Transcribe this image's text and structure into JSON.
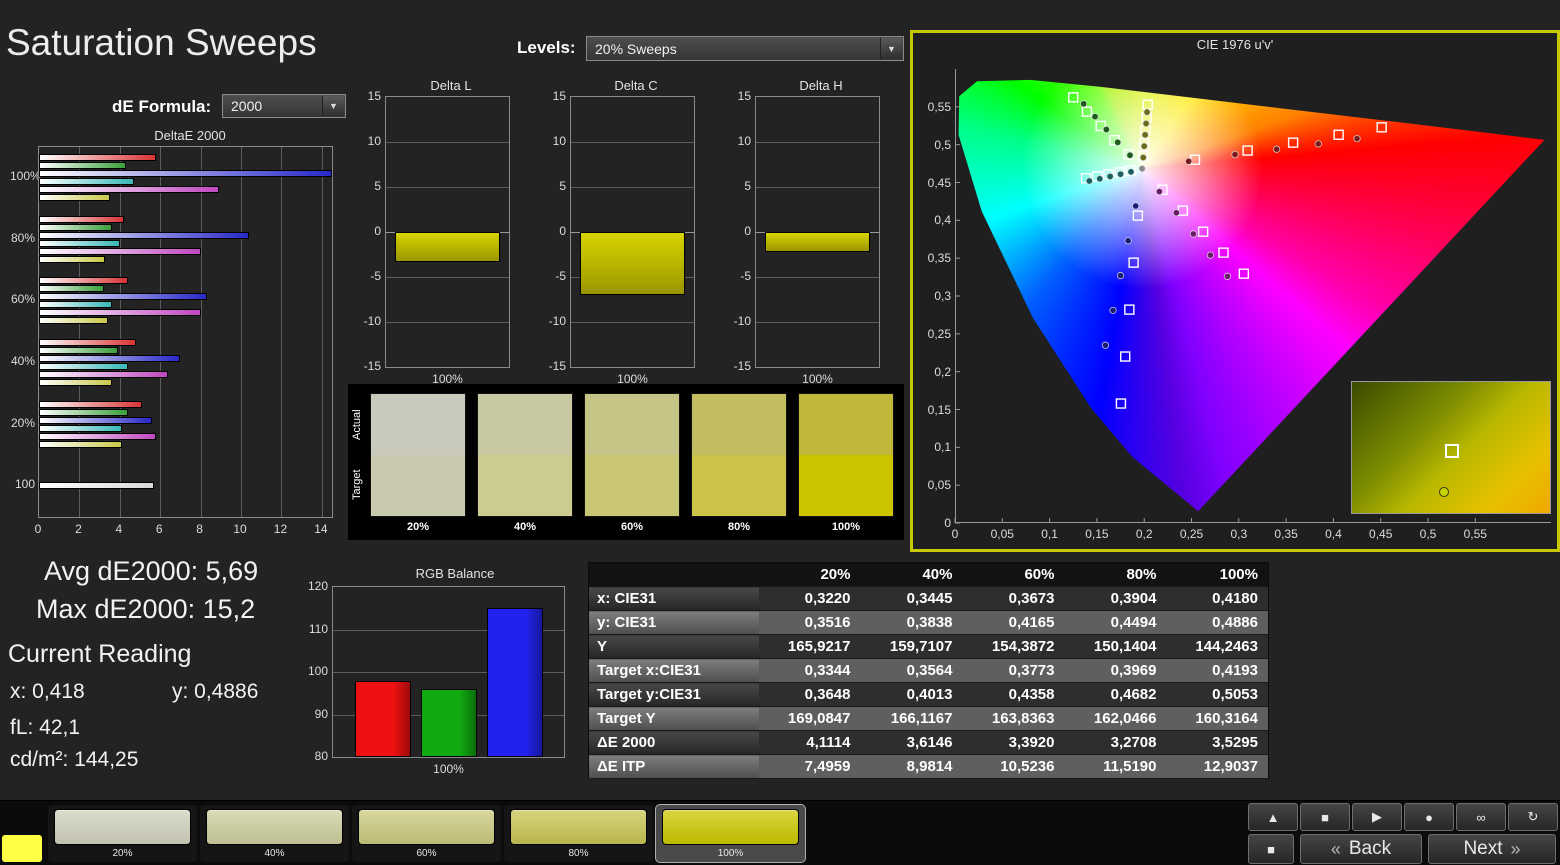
{
  "header": {
    "title": "Saturation Sweeps",
    "levels_label": "Levels:",
    "levels_value": "20% Sweeps",
    "de_formula_label": "dE Formula:",
    "de_formula_value": "2000",
    "accent_color": "#c8c800"
  },
  "stats": {
    "avg": "Avg dE2000: 5,69",
    "max": "Max dE2000: 15,2",
    "current_reading_title": "Current Reading",
    "x_value": "x: 0,418",
    "y_value": "y: 0,4886",
    "fl_value": "fL: 42,1",
    "cd_value": "cd/m²: 144,25"
  },
  "chart_data": {
    "deltae": {
      "type": "bar",
      "orientation": "horizontal",
      "title": "DeltaE 2000",
      "x_ticks": [
        0,
        2,
        4,
        6,
        8,
        10,
        12,
        14
      ],
      "xmax": 14.5,
      "groups": [
        {
          "label": "100%",
          "bars": [
            {
              "name": "red",
              "color": "#d83434",
              "v": 5.8
            },
            {
              "name": "green",
              "color": "#3aa03a",
              "v": 4.3
            },
            {
              "name": "blue",
              "color": "#2828c8",
              "v": 15.2
            },
            {
              "name": "cyan",
              "color": "#38b8b8",
              "v": 4.7
            },
            {
              "name": "magenta",
              "color": "#c048c0",
              "v": 8.9
            },
            {
              "name": "yellow",
              "color": "#c8c848",
              "v": 3.53
            }
          ]
        },
        {
          "label": "80%",
          "bars": [
            {
              "name": "red",
              "color": "#d83434",
              "v": 4.2
            },
            {
              "name": "green",
              "color": "#3aa03a",
              "v": 3.6
            },
            {
              "name": "blue",
              "color": "#2828c8",
              "v": 10.4
            },
            {
              "name": "cyan",
              "color": "#38b8b8",
              "v": 4.0
            },
            {
              "name": "magenta",
              "color": "#c048c0",
              "v": 8.0
            },
            {
              "name": "yellow",
              "color": "#c8c848",
              "v": 3.27
            }
          ]
        },
        {
          "label": "60%",
          "bars": [
            {
              "name": "red",
              "color": "#d83434",
              "v": 4.4
            },
            {
              "name": "green",
              "color": "#3aa03a",
              "v": 3.2
            },
            {
              "name": "blue",
              "color": "#2828c8",
              "v": 8.3
            },
            {
              "name": "cyan",
              "color": "#38b8b8",
              "v": 3.6
            },
            {
              "name": "magenta",
              "color": "#c048c0",
              "v": 8.0
            },
            {
              "name": "yellow",
              "color": "#c8c848",
              "v": 3.39
            }
          ]
        },
        {
          "label": "40%",
          "bars": [
            {
              "name": "red",
              "color": "#d83434",
              "v": 4.8
            },
            {
              "name": "green",
              "color": "#3aa03a",
              "v": 3.9
            },
            {
              "name": "blue",
              "color": "#2828c8",
              "v": 7.0
            },
            {
              "name": "cyan",
              "color": "#38b8b8",
              "v": 4.4
            },
            {
              "name": "magenta",
              "color": "#c048c0",
              "v": 6.4
            },
            {
              "name": "yellow",
              "color": "#c8c848",
              "v": 3.61
            }
          ]
        },
        {
          "label": "20%",
          "bars": [
            {
              "name": "red",
              "color": "#d83434",
              "v": 5.1
            },
            {
              "name": "green",
              "color": "#3aa03a",
              "v": 4.4
            },
            {
              "name": "blue",
              "color": "#2828c8",
              "v": 5.6
            },
            {
              "name": "cyan",
              "color": "#38b8b8",
              "v": 4.1
            },
            {
              "name": "magenta",
              "color": "#c048c0",
              "v": 5.8
            },
            {
              "name": "yellow",
              "color": "#c8c848",
              "v": 4.11
            }
          ]
        },
        {
          "label": "100",
          "bars": [
            {
              "name": "white",
              "color": "#d8d8d8",
              "v": 5.7
            }
          ]
        }
      ]
    },
    "delta_bars": [
      {
        "title": "Delta L",
        "xlabel": "100%",
        "v": -3.3,
        "ymin": -15,
        "ymax": 15,
        "ticks": [
          15,
          10,
          5,
          0,
          -5,
          -10,
          -15
        ],
        "bar_color": "#d8d400"
      },
      {
        "title": "Delta C",
        "xlabel": "100%",
        "v": -7.0,
        "ymin": -15,
        "ymax": 15,
        "ticks": [
          15,
          10,
          5,
          0,
          -5,
          -10,
          -15
        ],
        "bar_color": "#d8d400"
      },
      {
        "title": "Delta H",
        "xlabel": "100%",
        "v": -2.2,
        "ymin": -15,
        "ymax": 15,
        "ticks": [
          15,
          10,
          5,
          0,
          -5,
          -10,
          -15
        ],
        "bar_color": "#d8d400"
      }
    ],
    "rgb_balance": {
      "type": "bar",
      "title": "RGB Balance",
      "xlabel": "100%",
      "ymin": 80,
      "ymax": 120,
      "ticks": [
        120,
        110,
        100,
        90,
        80
      ],
      "bars": [
        {
          "name": "red",
          "color": "#ee1111",
          "v": 98
        },
        {
          "name": "green",
          "color": "#11aa11",
          "v": 96
        },
        {
          "name": "blue",
          "color": "#2222ee",
          "v": 115
        }
      ]
    },
    "cie": {
      "type": "scatter",
      "title": "CIE 1976 u'v'",
      "umax": 0.63,
      "vmax": 0.6,
      "tick_values": [
        0,
        0.05,
        0.1,
        0.15,
        0.2,
        0.25,
        0.3,
        0.35,
        0.4,
        0.45,
        0.5,
        0.55
      ],
      "tick_labels": [
        "0",
        "0,05",
        "0,1",
        "0,15",
        "0,2",
        "0,25",
        "0,3",
        "0,35",
        "0,4",
        "0,45",
        "0,5",
        "0,55"
      ],
      "white_point": [
        0.1978,
        0.4683
      ],
      "targets": [
        [
          0.2537,
          0.4801
        ],
        [
          0.3093,
          0.4922
        ],
        [
          0.3574,
          0.5027
        ],
        [
          0.4055,
          0.5131
        ],
        [
          0.451,
          0.5229
        ],
        [
          0.1832,
          0.4871
        ],
        [
          0.1686,
          0.5059
        ],
        [
          0.154,
          0.5248
        ],
        [
          0.1395,
          0.5436
        ],
        [
          0.125,
          0.5625
        ],
        [
          0.1933,
          0.4062
        ],
        [
          0.1888,
          0.3441
        ],
        [
          0.1843,
          0.282
        ],
        [
          0.1799,
          0.22
        ],
        [
          0.1754,
          0.1579
        ],
        [
          0.1859,
          0.4658
        ],
        [
          0.1741,
          0.4633
        ],
        [
          0.1622,
          0.4608
        ],
        [
          0.1504,
          0.4582
        ],
        [
          0.1385,
          0.4557
        ],
        [
          0.2193,
          0.4405
        ],
        [
          0.2408,
          0.4128
        ],
        [
          0.2623,
          0.385
        ],
        [
          0.2838,
          0.3573
        ],
        [
          0.3053,
          0.3295
        ],
        [
          0.199,
          0.4852
        ],
        [
          0.2002,
          0.5021
        ],
        [
          0.2014,
          0.519
        ],
        [
          0.2026,
          0.5359
        ],
        [
          0.2038,
          0.5528
        ]
      ],
      "measurements": [
        {
          "u": 0.247,
          "v": 0.478,
          "color": "#7a1a1a"
        },
        {
          "u": 0.296,
          "v": 0.487,
          "color": "#7a1a1a"
        },
        {
          "u": 0.34,
          "v": 0.494,
          "color": "#7a1a1a"
        },
        {
          "u": 0.384,
          "v": 0.501,
          "color": "#7a1a1a"
        },
        {
          "u": 0.425,
          "v": 0.508,
          "color": "#7a1a1a"
        },
        {
          "u": 0.185,
          "v": 0.486,
          "color": "#1a5c1a"
        },
        {
          "u": 0.172,
          "v": 0.503,
          "color": "#1a5c1a"
        },
        {
          "u": 0.16,
          "v": 0.52,
          "color": "#1a5c1a"
        },
        {
          "u": 0.148,
          "v": 0.537,
          "color": "#1a5c1a"
        },
        {
          "u": 0.136,
          "v": 0.554,
          "color": "#1a5c1a"
        },
        {
          "u": 0.191,
          "v": 0.419,
          "color": "#1a1a7a"
        },
        {
          "u": 0.183,
          "v": 0.373,
          "color": "#1a1a7a"
        },
        {
          "u": 0.175,
          "v": 0.327,
          "color": "#1a1a7a"
        },
        {
          "u": 0.167,
          "v": 0.281,
          "color": "#1a1a7a"
        },
        {
          "u": 0.159,
          "v": 0.235,
          "color": "#1a1a7a"
        },
        {
          "u": 0.186,
          "v": 0.464,
          "color": "#1a6060"
        },
        {
          "u": 0.175,
          "v": 0.461,
          "color": "#1a6060"
        },
        {
          "u": 0.164,
          "v": 0.458,
          "color": "#1a6060"
        },
        {
          "u": 0.153,
          "v": 0.455,
          "color": "#1a6060"
        },
        {
          "u": 0.142,
          "v": 0.452,
          "color": "#1a6060"
        },
        {
          "u": 0.216,
          "v": 0.438,
          "color": "#6a1a6a"
        },
        {
          "u": 0.234,
          "v": 0.41,
          "color": "#6a1a6a"
        },
        {
          "u": 0.252,
          "v": 0.382,
          "color": "#6a1a6a"
        },
        {
          "u": 0.27,
          "v": 0.354,
          "color": "#6a1a6a"
        },
        {
          "u": 0.288,
          "v": 0.326,
          "color": "#6a1a6a"
        },
        {
          "u": 0.199,
          "v": 0.483,
          "color": "#6a6a1a"
        },
        {
          "u": 0.2,
          "v": 0.498,
          "color": "#6a6a1a"
        },
        {
          "u": 0.201,
          "v": 0.513,
          "color": "#6a6a1a"
        },
        {
          "u": 0.202,
          "v": 0.528,
          "color": "#6a6a1a"
        },
        {
          "u": 0.203,
          "v": 0.543,
          "color": "#6a6a1a"
        },
        {
          "u": 0.1978,
          "v": 0.4683,
          "color": "#8a8a8a"
        }
      ],
      "inset": {
        "square_pos": [
          0.47,
          0.47
        ],
        "dot_pos": [
          0.44,
          0.8
        ]
      }
    }
  },
  "swatch_panel": {
    "row_labels": [
      "Actual",
      "Target"
    ],
    "columns": [
      {
        "label": "20%",
        "actual": "#c9cabc",
        "target": "#c9c9b0"
      },
      {
        "label": "40%",
        "actual": "#c8c8a2",
        "target": "#cbcb92"
      },
      {
        "label": "60%",
        "actual": "#c5c386",
        "target": "#c9c774"
      },
      {
        "label": "80%",
        "actual": "#c2bd60",
        "target": "#cbc34a"
      },
      {
        "label": "100%",
        "actual": "#c1b73a",
        "target": "#cdc400"
      }
    ]
  },
  "table": {
    "columns": [
      "20%",
      "40%",
      "60%",
      "80%",
      "100%"
    ],
    "rows": [
      {
        "label": "x: CIE31",
        "values": [
          "0,3220",
          "0,3445",
          "0,3673",
          "0,3904",
          "0,4180"
        ]
      },
      {
        "label": "y: CIE31",
        "values": [
          "0,3516",
          "0,3838",
          "0,4165",
          "0,4494",
          "0,4886"
        ]
      },
      {
        "label": "Y",
        "values": [
          "165,9217",
          "159,7107",
          "154,3872",
          "150,1404",
          "144,2463"
        ]
      },
      {
        "label": "Target x:CIE31",
        "values": [
          "0,3344",
          "0,3564",
          "0,3773",
          "0,3969",
          "0,4193"
        ]
      },
      {
        "label": "Target y:CIE31",
        "values": [
          "0,3648",
          "0,4013",
          "0,4358",
          "0,4682",
          "0,5053"
        ]
      },
      {
        "label": "Target Y",
        "values": [
          "169,0847",
          "166,1167",
          "163,8363",
          "162,0466",
          "160,3164"
        ]
      },
      {
        "label": "ΔE 2000",
        "values": [
          "4,1114",
          "3,6146",
          "3,3920",
          "3,2708",
          "3,5295"
        ]
      },
      {
        "label": "ΔE ITP",
        "values": [
          "7,4959",
          "8,9814",
          "10,5236",
          "11,5190",
          "12,9037"
        ]
      }
    ]
  },
  "bottom_bar": {
    "current_patch_color": "#ffff44",
    "patches": [
      {
        "label": "20%",
        "color": "#d2d2bd",
        "selected": false
      },
      {
        "label": "40%",
        "color": "#cfcf9f",
        "selected": false
      },
      {
        "label": "60%",
        "color": "#cbca7f",
        "selected": false
      },
      {
        "label": "80%",
        "color": "#c9c554",
        "selected": false
      },
      {
        "label": "100%",
        "color": "#cdc900",
        "selected": true
      }
    ],
    "mini_buttons": [
      {
        "name": "eject-button",
        "glyph": "▲"
      },
      {
        "name": "stop-button",
        "glyph": "■"
      },
      {
        "name": "play-button",
        "glyph": "▶"
      },
      {
        "name": "record-button",
        "glyph": "●"
      },
      {
        "name": "continuous-button",
        "glyph": "∞"
      },
      {
        "name": "refresh-button",
        "glyph": "↻"
      }
    ],
    "stop_glyph": "■",
    "back_arrow": "«",
    "back_label": "Back",
    "next_label": "Next",
    "next_arrow": "»"
  }
}
